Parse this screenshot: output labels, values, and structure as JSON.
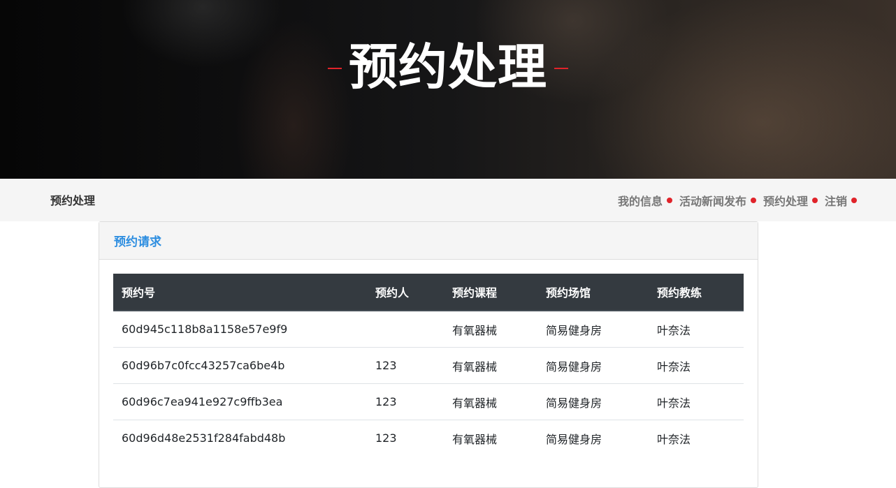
{
  "hero": {
    "title": "预约处理"
  },
  "navbar": {
    "brand": "预约处理",
    "links": [
      {
        "label": "我的信息"
      },
      {
        "label": "活动新闻发布"
      },
      {
        "label": "预约处理"
      },
      {
        "label": "注销"
      }
    ]
  },
  "panel": {
    "title": "预约请求",
    "columns": [
      "预约号",
      "预约人",
      "预约课程",
      "预约场馆",
      "预约教练"
    ],
    "rows": [
      [
        "60d945c118b8a1158e57e9f9",
        "",
        "有氧器械",
        "简易健身房",
        "叶奈法"
      ],
      [
        "60d96b7c0fcc43257ca6be4b",
        "123",
        "有氧器械",
        "简易健身房",
        "叶奈法"
      ],
      [
        "60d96c7ea941e927c9ffb3ea",
        "123",
        "有氧器械",
        "简易健身房",
        "叶奈法"
      ],
      [
        "60d96d48e2531f284fabd48b",
        "123",
        "有氧器械",
        "简易健身房",
        "叶奈法"
      ]
    ]
  },
  "colors": {
    "accent_red": "#e0232a",
    "title_blue": "#2e8ee0",
    "table_header_bg": "#343a40"
  }
}
